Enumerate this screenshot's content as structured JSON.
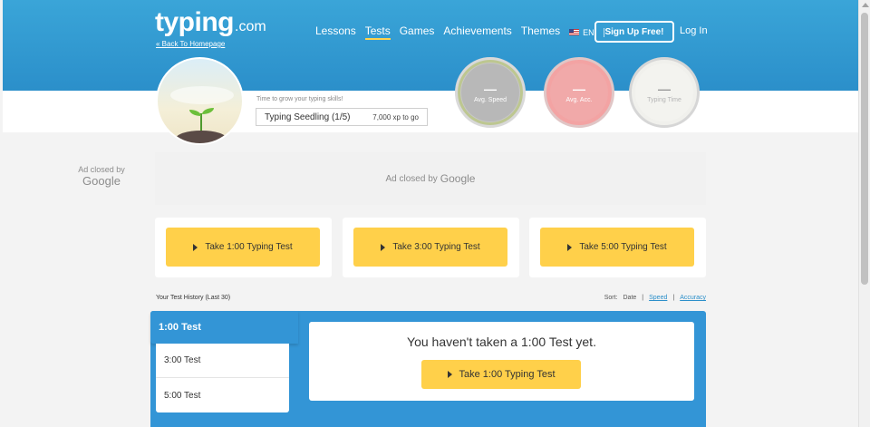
{
  "header": {
    "logo_main": "typing",
    "logo_domain": ".com",
    "back_link": "« Back To Homepage",
    "nav": [
      "Lessons",
      "Tests",
      "Games",
      "Achievements",
      "Themes"
    ],
    "active_nav": "Tests",
    "language": "EN",
    "signup_label": "Sign Up Free!",
    "login_label": "Log In"
  },
  "profile": {
    "tagline": "Time to grow your typing skills!",
    "level_name": "Typing Seedling (1/5)",
    "xp_to_go": "7,000 xp to go"
  },
  "stats": [
    {
      "value": "—",
      "label": "Avg. Speed"
    },
    {
      "value": "—",
      "label": "Avg. Acc."
    },
    {
      "value": "—",
      "label": "Typing Time"
    }
  ],
  "ads": {
    "side_text": "Ad closed by",
    "side_brand": "Google",
    "main_text": "Ad closed by",
    "main_brand": "Google"
  },
  "test_cards": [
    {
      "label": "Take 1:00 Typing Test"
    },
    {
      "label": "Take 3:00 Typing Test"
    },
    {
      "label": "Take 5:00 Typing Test"
    }
  ],
  "history": {
    "title": "Your Test History (Last 30)",
    "sort_label": "Sort:",
    "sort_options": [
      "Date",
      "Speed",
      "Accuracy"
    ],
    "tabs": [
      "1:00 Test",
      "3:00 Test",
      "5:00 Test"
    ],
    "empty_message": "You haven't taken a 1:00 Test yet.",
    "empty_button": "Take 1:00 Typing Test"
  },
  "colors": {
    "header_blue": "#2b8fca",
    "button_yellow": "#ffd04a",
    "panel_blue": "#3395d6"
  }
}
